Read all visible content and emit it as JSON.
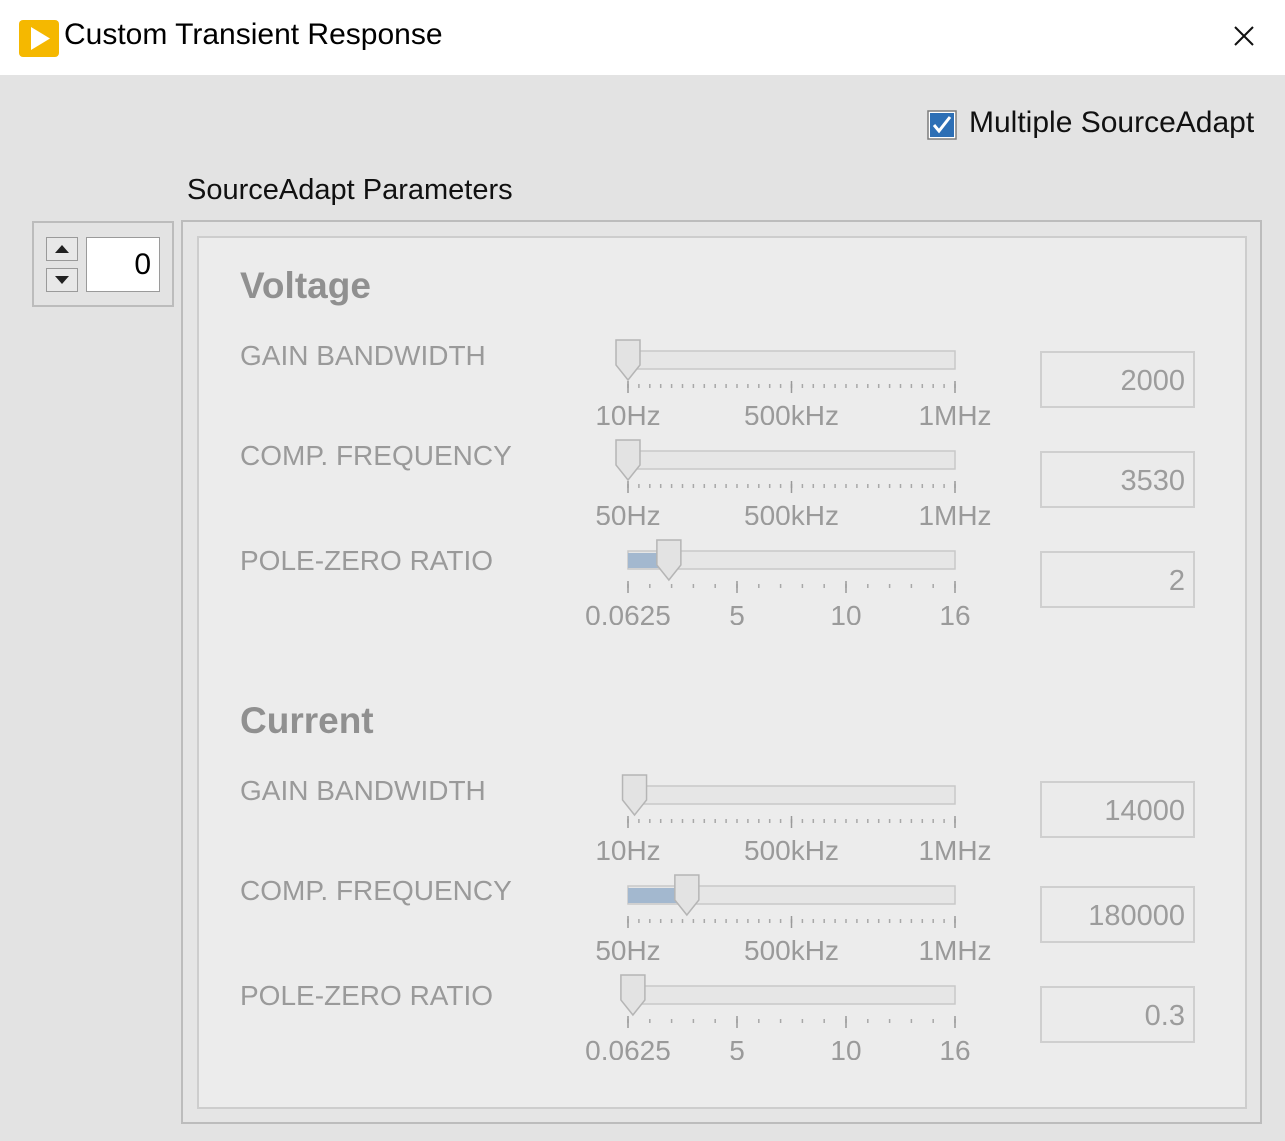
{
  "window": {
    "title": "Custom Transient Response"
  },
  "options": {
    "multiple_sourceadapt": {
      "label": "Multiple SourceAdapt",
      "checked": true
    }
  },
  "params": {
    "label": "SourceAdapt Parameters"
  },
  "index": {
    "value": "0"
  },
  "sections": [
    {
      "title": "Voltage",
      "rows": [
        {
          "label": "GAIN BANDWIDTH",
          "value": "2000",
          "level": 0.0,
          "ticks": [
            "10Hz",
            "500kHz",
            "1MHz"
          ],
          "fill": false
        },
        {
          "label": "COMP. FREQUENCY",
          "value": "3530",
          "level": 0.0,
          "ticks": [
            "50Hz",
            "500kHz",
            "1MHz"
          ],
          "fill": false
        },
        {
          "label": "POLE-ZERO RATIO",
          "value": "2",
          "level": 0.125,
          "ticks": [
            "0.0625",
            "5",
            "10",
            "16"
          ],
          "fill": true
        }
      ]
    },
    {
      "title": "Current",
      "rows": [
        {
          "label": "GAIN BANDWIDTH",
          "value": "14000",
          "level": 0.02,
          "ticks": [
            "10Hz",
            "500kHz",
            "1MHz"
          ],
          "fill": false
        },
        {
          "label": "COMP. FREQUENCY",
          "value": "180000",
          "level": 0.18,
          "ticks": [
            "50Hz",
            "500kHz",
            "1MHz"
          ],
          "fill": true
        },
        {
          "label": "POLE-ZERO RATIO",
          "value": "0.3",
          "level": 0.015,
          "ticks": [
            "0.0625",
            "5",
            "10",
            "16"
          ],
          "fill": false
        }
      ]
    }
  ],
  "colors": {
    "accent": "#a3b8cf",
    "check": "#2d6fb5",
    "disabled_text": "#9a9a9a"
  }
}
